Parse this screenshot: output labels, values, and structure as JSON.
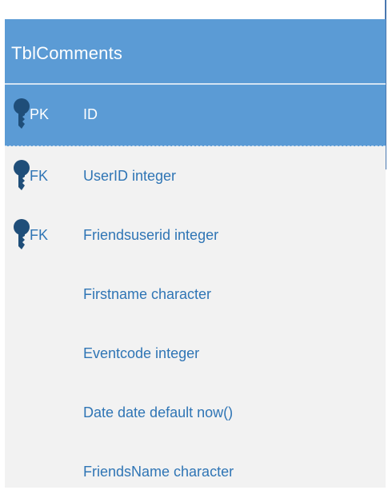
{
  "table": {
    "title": "TblComments",
    "primary": {
      "key": "PK",
      "field": "ID"
    },
    "rows": [
      {
        "key": "FK",
        "field": "UserID integer"
      },
      {
        "key": "FK",
        "field": "Friendsuserid integer"
      },
      {
        "key": "",
        "field": "Firstname character"
      },
      {
        "key": "",
        "field": "Eventcode integer"
      },
      {
        "key": "",
        "field": "Date date default now()"
      },
      {
        "key": "",
        "field": "FriendsName character"
      }
    ]
  },
  "colors": {
    "header_bg": "#5b9bd5",
    "body_bg": "#f2f2f2",
    "text_blue": "#2f75b5",
    "key_icon": "#1f4e79"
  }
}
